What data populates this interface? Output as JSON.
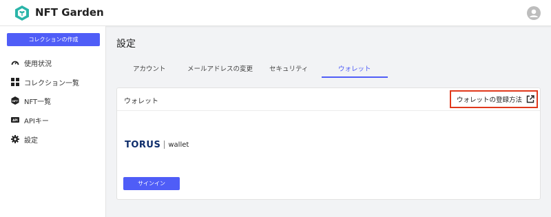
{
  "header": {
    "brand": "NFT Garden"
  },
  "sidebar": {
    "create_button": "コレクションの作成",
    "items": [
      {
        "label": "使用状況",
        "icon": "speedometer-icon"
      },
      {
        "label": "コレクション一覧",
        "icon": "grid-icon"
      },
      {
        "label": "NFT一覧",
        "icon": "nft-icon"
      },
      {
        "label": "APIキー",
        "icon": "api-icon"
      },
      {
        "label": "設定",
        "icon": "gear-icon"
      }
    ]
  },
  "main": {
    "title": "設定",
    "tabs": [
      {
        "label": "アカウント",
        "active": false
      },
      {
        "label": "メールアドレスの変更",
        "active": false
      },
      {
        "label": "セキュリティ",
        "active": false
      },
      {
        "label": "ウォレット",
        "active": true
      }
    ],
    "card": {
      "title": "ウォレット",
      "howto_link": "ウォレットの登録方法",
      "provider_brand": "TORUS",
      "provider_suffix": "wallet",
      "signin_button": "サインイン"
    }
  },
  "colors": {
    "accent": "#4f5df7",
    "highlight_border": "#e0381b",
    "logo": "#2bb5a9"
  }
}
